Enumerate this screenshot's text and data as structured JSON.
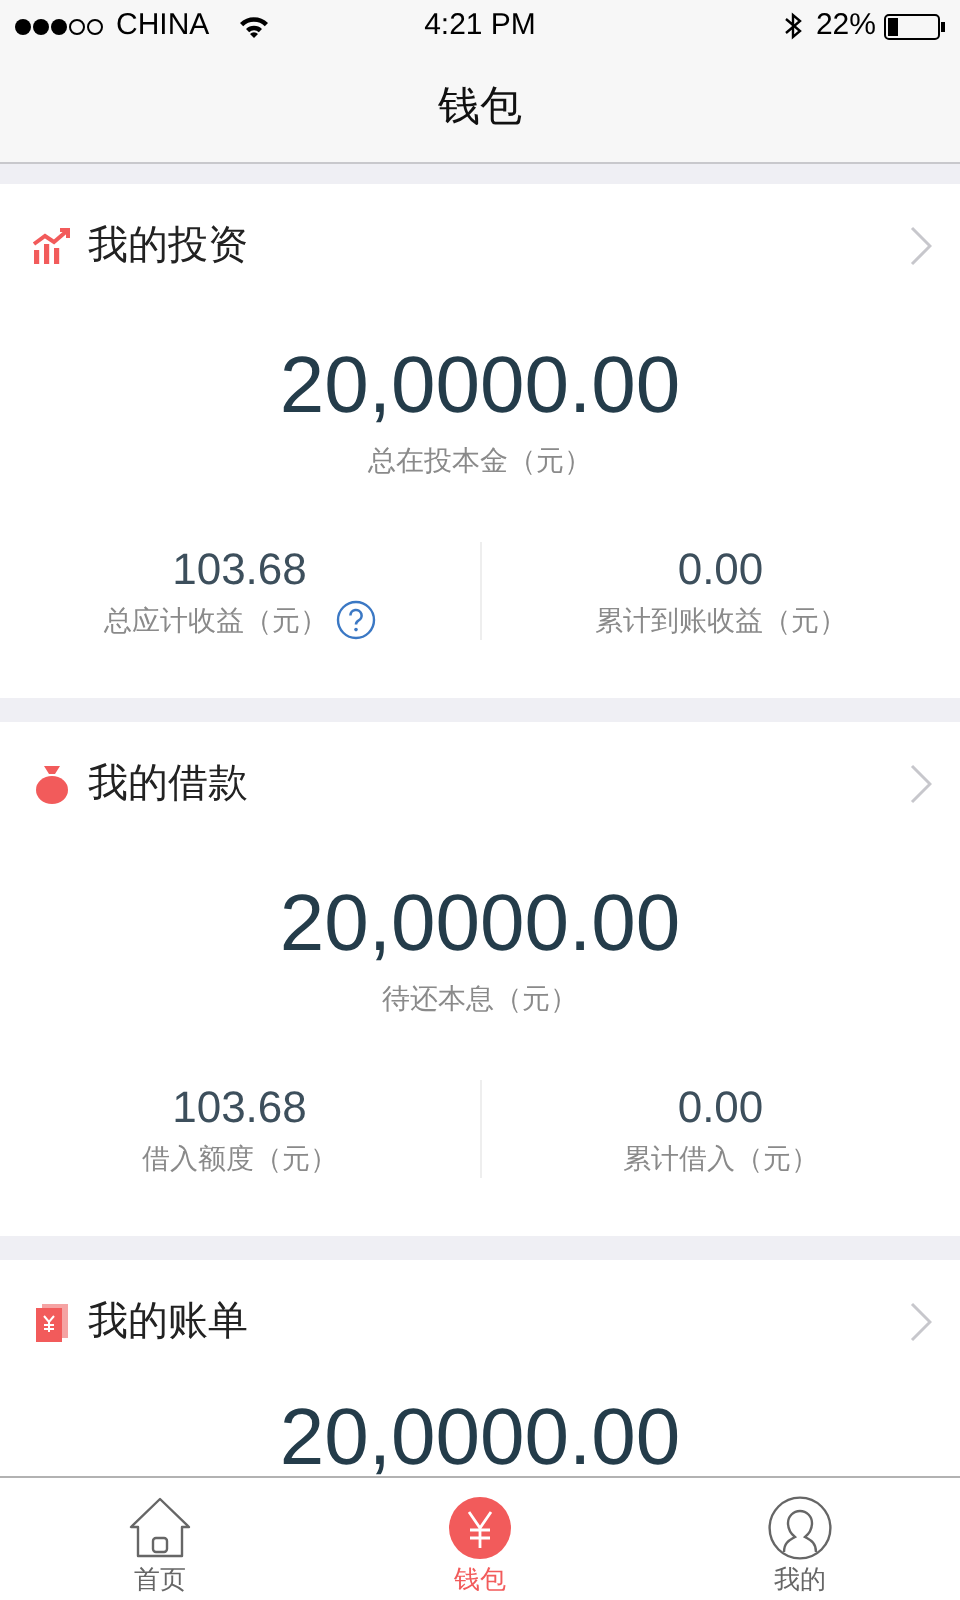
{
  "status_bar": {
    "carrier": "CHINA",
    "time": "4:21 PM",
    "battery": "22%"
  },
  "nav_bar": {
    "title": "钱包"
  },
  "sections": [
    {
      "kind": "investment",
      "title": "我的投资",
      "amount": "20,0000.00",
      "amount_label": "总在投本金（元）",
      "stats": [
        {
          "value": "103.68",
          "label": "总应计收益（元）",
          "has_help": true
        },
        {
          "value": "0.00",
          "label": "累计到账收益（元）",
          "has_help": false
        }
      ]
    },
    {
      "kind": "loan",
      "title": "我的借款",
      "amount": "20,0000.00",
      "amount_label": "待还本息（元）",
      "stats": [
        {
          "value": "103.68",
          "label": "借入额度（元）",
          "has_help": false
        },
        {
          "value": "0.00",
          "label": "累计借入（元）",
          "has_help": false
        }
      ]
    },
    {
      "kind": "bill",
      "title": "我的账单",
      "amount": "20,0000.00"
    }
  ],
  "tab_bar": [
    {
      "kind": "home",
      "label": "首页",
      "selected": false
    },
    {
      "kind": "wallet",
      "label": "钱包",
      "selected": true
    },
    {
      "kind": "profile",
      "label": "我的",
      "selected": false
    }
  ]
}
